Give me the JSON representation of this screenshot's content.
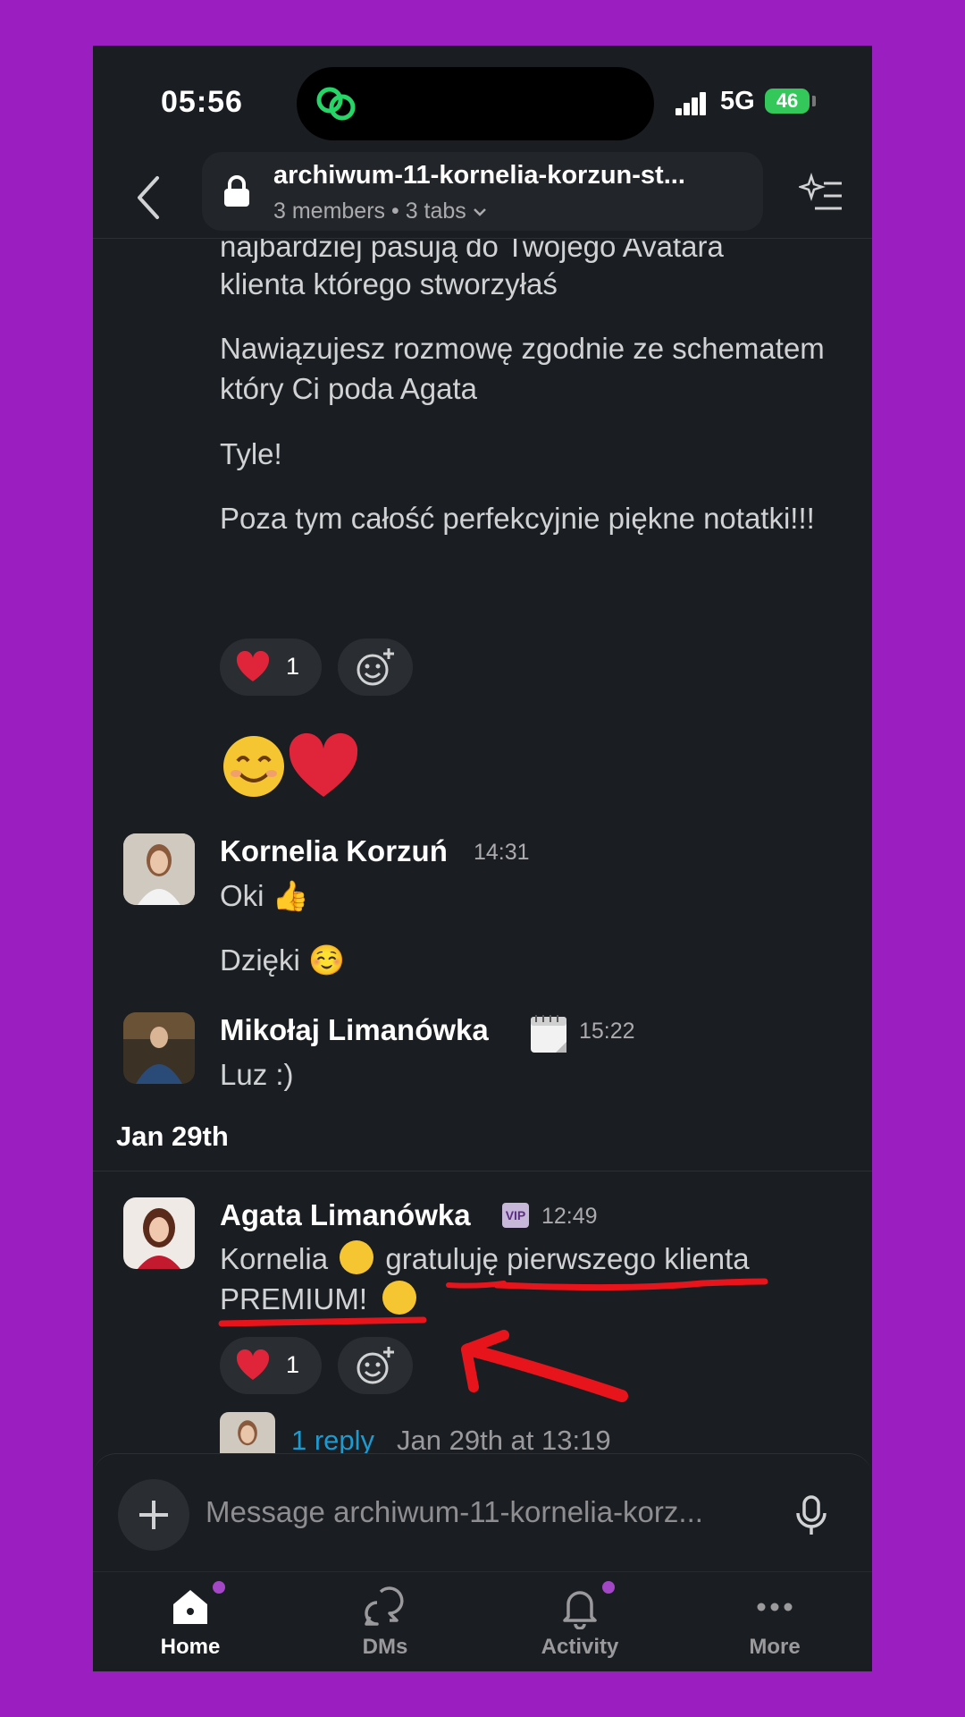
{
  "status_bar": {
    "time": "05:56",
    "network": "5G",
    "battery": "46"
  },
  "header": {
    "channel_name": "archiwum-11-kornelia-korzun-st...",
    "members": "3 members",
    "tabs": "3 tabs"
  },
  "messages": {
    "partial_line": "najbardziej pasują do Twojego Avatara",
    "msg1_line2": "klienta którego stworzyłaś",
    "msg2": "Nawiązujesz rozmowę zgodnie ze schematem który Ci poda Agata",
    "msg3": "Tyle!",
    "msg4": "Poza tym całość perfekcyjnie piękne notatki!!!",
    "reaction1_count": "1",
    "kornelia": {
      "author": "Kornelia Korzuń",
      "time": "14:31",
      "text1": "Oki 👍",
      "text2": "Dzięki ☺️"
    },
    "mikolaj": {
      "author": "Mikołaj Limanówka",
      "time": "15:22",
      "text": "Luz :)"
    },
    "date_divider": "Jan 29th",
    "agata": {
      "author": "Agata Limanówka",
      "badge": "VIP",
      "time": "12:49",
      "text_a": "Kornelia",
      "text_b": "gratuluję pierwszego klienta",
      "text_c": "PREMIUM!",
      "reaction_count": "1",
      "reply_count": "1 reply",
      "reply_time": "Jan 29th at 13:19"
    }
  },
  "composer": {
    "placeholder": "Message archiwum-11-kornelia-korz..."
  },
  "nav": {
    "home": "Home",
    "dms": "DMs",
    "activity": "Activity",
    "more": "More"
  },
  "colors": {
    "background": "#1a1d21",
    "accent": "#1d9bd1",
    "annotation": "#e8141c",
    "frame": "#9b1ec1"
  }
}
